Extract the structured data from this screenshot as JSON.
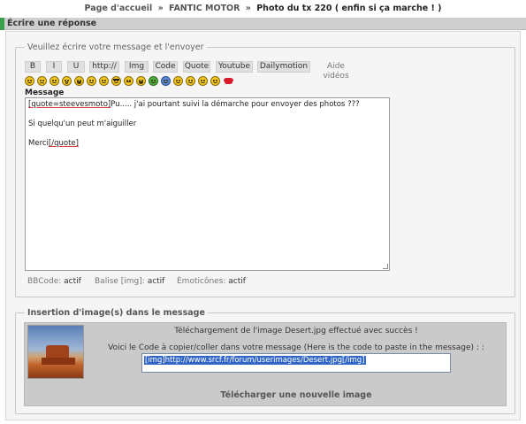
{
  "breadcrumb": {
    "home": "Page d'accueil",
    "sep1": "»",
    "forum": "FANTIC MOTOR",
    "sep2": "»",
    "topic": "Photo du tx 220 ( enfin si ça marche ! )"
  },
  "page_title": "Écrire une réponse",
  "message_box": {
    "legend": "Veuillez écrire votre message et l'envoyer",
    "toolbar": [
      {
        "label": "B"
      },
      {
        "label": "I"
      },
      {
        "label": "U"
      },
      {
        "label": "http://"
      },
      {
        "label": "Img"
      },
      {
        "label": "Code"
      },
      {
        "label": "Quote"
      },
      {
        "label": "Youtube"
      },
      {
        "label": "Dailymotion"
      },
      {
        "label": "Aide vidéos"
      }
    ],
    "smilies": [
      "smile-icon",
      "sad-icon",
      "wink-icon",
      "surprised-icon",
      "laugh-icon",
      "smile-icon",
      "smile-icon",
      "cool-icon",
      "angry-icon",
      "happy-icon",
      "green-smiley-icon",
      "blue-smiley-icon",
      "smile-icon",
      "smile-icon",
      "smile-icon",
      "smile-icon",
      "lips-icon"
    ],
    "message_label": "Message",
    "content": {
      "quote_open": "[quote=steevesmoto]",
      "line1_rest": "Pu..... j'ai pourtant suivi la démarche pour envoyer des photos ???",
      "line2": "Si quelqu'un peut m'aiguiller",
      "line3": "Merci",
      "quote_close": "[/quote]"
    },
    "status": {
      "bbcode_label": "BBCode:",
      "bbcode_value": "actif",
      "img_label": "Balise [img]:",
      "img_value": "actif",
      "emoticons_label": "Émoticônes:",
      "emoticons_value": "actif"
    }
  },
  "upload_box": {
    "legend": "Insertion d'image(s) dans le message",
    "success_text": "Téléchargement de l'image Desert.jpg effectué avec succès !",
    "code_label": "Voici le Code à copier/coller dans votre message (Here is the code to paste in the message) : :",
    "code_value": "[img]http://www.srcf.fr/forum/userimages/Desert.jpg[/img]",
    "new_upload": "Télécharger une nouvelle image"
  }
}
